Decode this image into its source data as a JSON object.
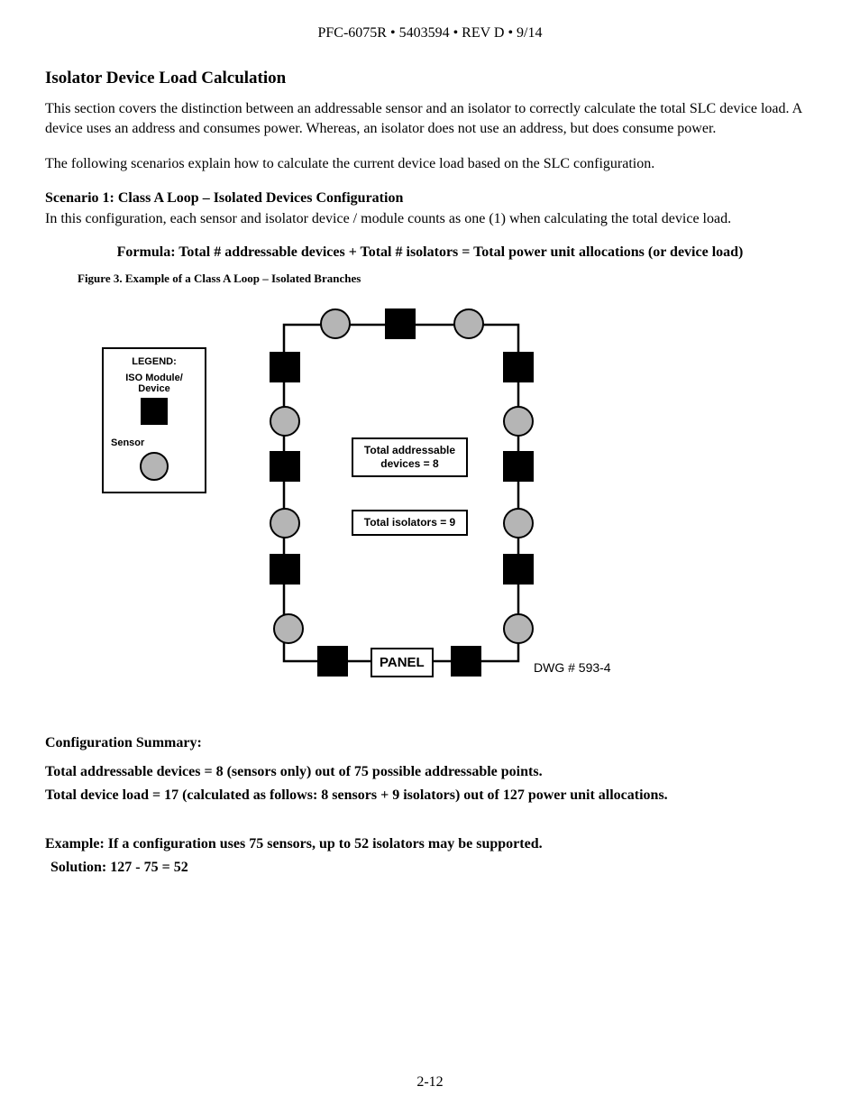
{
  "header": "PFC-6075R • 5403594 • REV D • 9/14",
  "section_title": "Isolator Device Load Calculation",
  "para1": "This section covers the distinction between an addressable sensor and an isolator to correctly calculate the total SLC device load. A device uses an address and consumes power. Whereas, an isolator does not use an address, but does consume power.",
  "para2": "The following scenarios explain how to calculate the current device load based on the SLC configuration.",
  "scenario1_title": "Scenario 1: Class A Loop – Isolated Devices Configuration",
  "scenario1_text": "In this configuration, each sensor and isolator device / module counts as one (1) when calculating the total device load.",
  "formula": "Formula: Total # addressable devices + Total # isolators = Total power unit allocations (or device load)",
  "figure_caption": "Figure 3. Example of a Class A Loop – Isolated Branches",
  "legend": {
    "title": "LEGEND:",
    "iso": "ISO Module/ Device",
    "sensor": "Sensor"
  },
  "diagram": {
    "panel": "PANEL",
    "addressable": "Total addressable devices = 8",
    "isolators": "Total isolators = 9",
    "dwg": "DWG # 593-4"
  },
  "summary": {
    "title": "Configuration Summary:",
    "line1": "Total addressable devices = 8 (sensors only) out of 75 possible addressable points.",
    "line2": "Total device load = 17 (calculated as follows: 8 sensors + 9 isolators) out of 127 power unit allocations."
  },
  "example": "Example: If a configuration uses 75 sensors, up to 52 isolators may be supported.",
  "solution": "Solution:  127 - 75 = 52",
  "page_number": "2-12",
  "chart_data": {
    "type": "diagram",
    "title": "Class A Loop – Isolated Branches",
    "legend": [
      {
        "symbol": "black-square",
        "meaning": "ISO Module/Device"
      },
      {
        "symbol": "grey-circle",
        "meaning": "Sensor"
      }
    ],
    "totals": {
      "addressable_devices": 8,
      "isolators": 9,
      "device_load": 17,
      "max_addressable_points": 75,
      "max_power_unit_allocations": 127
    },
    "example_solution": {
      "sensors": 75,
      "max_isolators": 52,
      "equation": "127 - 75 = 52"
    },
    "dwg": "593-4"
  }
}
